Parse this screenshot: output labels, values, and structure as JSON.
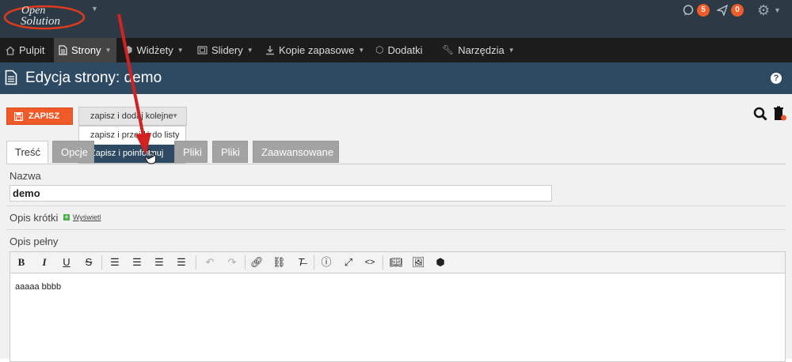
{
  "header": {
    "logo": "Open Solution",
    "messages_count": "5",
    "notifications_count": "0"
  },
  "menu": [
    {
      "label": "Pulpit",
      "icon": "home-icon"
    },
    {
      "label": "Strony",
      "icon": "document-icon",
      "active": true
    },
    {
      "label": "Widżety",
      "icon": "cube-icon"
    },
    {
      "label": "Slidery",
      "icon": "slides-icon"
    },
    {
      "label": "Kopie zapasowe",
      "icon": "download-icon"
    },
    {
      "label": "Dodatki",
      "icon": "cubes-icon"
    },
    {
      "label": "Narzędzia",
      "icon": "wrench-icon"
    }
  ],
  "page": {
    "title": "Edycja strony: demo"
  },
  "actions": {
    "save_label": "ZAPISZ",
    "dropdown_label": "zapisz i dodaj kolejne",
    "dropdown_items": [
      "zapisz i przejdź do listy",
      "Zapisz i poinformuj"
    ]
  },
  "tabs": [
    "Treść",
    "Opcje",
    "Pliki",
    "Pliki",
    "Zaawansowane"
  ],
  "form": {
    "name_label": "Nazwa",
    "name_value": "demo",
    "short_desc_label": "Opis krótki",
    "show_label": "Wyświetl",
    "full_desc_label": "Opis pełny",
    "editor_content": "aaaaa bbbb"
  },
  "colors": {
    "accent": "#f05a28",
    "nav_dark": "#2e4a63",
    "annotation_arrow": "#d32020"
  }
}
